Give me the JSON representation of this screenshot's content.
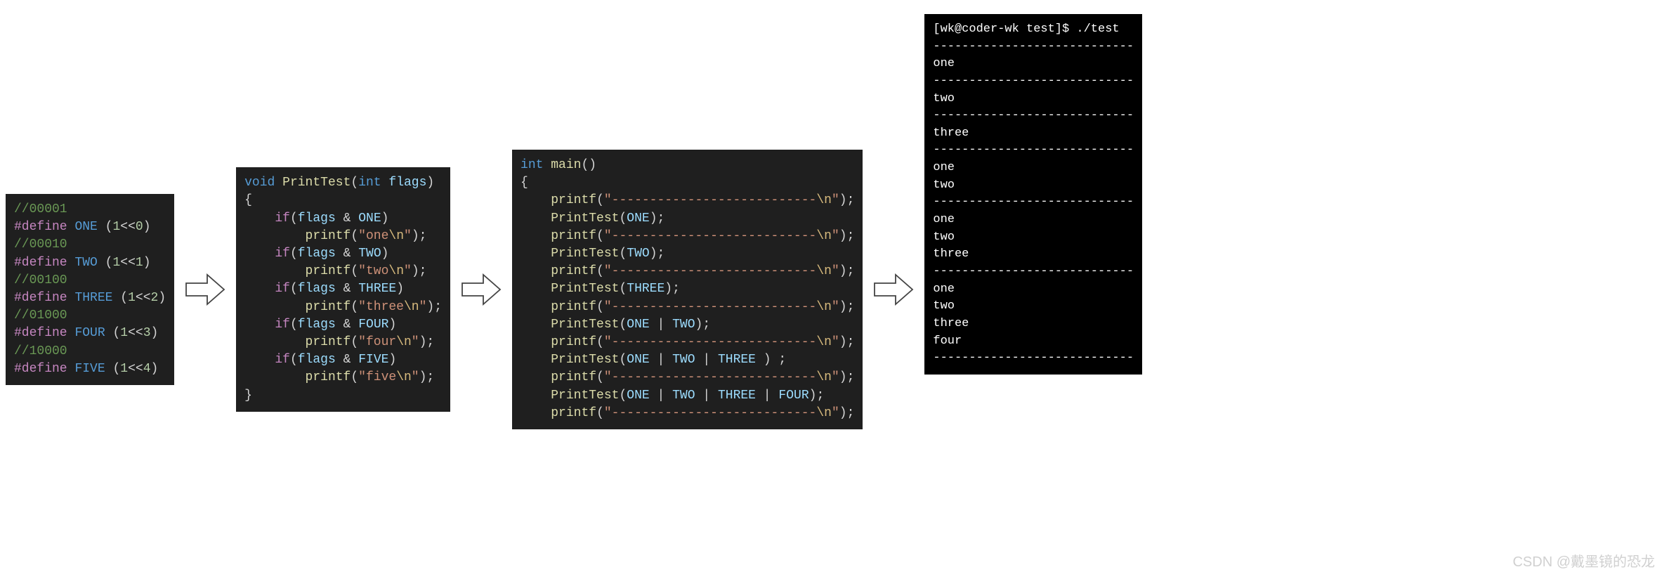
{
  "block1": {
    "lines": [
      [
        [
          "c-comment",
          "//00001"
        ]
      ],
      [
        [
          "c-kw",
          "#define"
        ],
        [
          "",
          " "
        ],
        [
          "c-define",
          "ONE"
        ],
        [
          "",
          " "
        ],
        [
          "c-paren",
          "("
        ],
        [
          "c-num",
          "1"
        ],
        [
          "c-op",
          "<<"
        ],
        [
          "c-num",
          "0"
        ],
        [
          "c-paren",
          ")"
        ]
      ],
      [
        [
          "c-comment",
          "//00010"
        ]
      ],
      [
        [
          "c-kw",
          "#define"
        ],
        [
          "",
          " "
        ],
        [
          "c-define",
          "TWO"
        ],
        [
          "",
          " "
        ],
        [
          "c-paren",
          "("
        ],
        [
          "c-num",
          "1"
        ],
        [
          "c-op",
          "<<"
        ],
        [
          "c-num",
          "1"
        ],
        [
          "c-paren",
          ")"
        ]
      ],
      [
        [
          "c-comment",
          "//00100"
        ]
      ],
      [
        [
          "c-kw",
          "#define"
        ],
        [
          "",
          " "
        ],
        [
          "c-define",
          "THREE"
        ],
        [
          "",
          " "
        ],
        [
          "c-paren",
          "("
        ],
        [
          "c-num",
          "1"
        ],
        [
          "c-op",
          "<<"
        ],
        [
          "c-num",
          "2"
        ],
        [
          "c-paren",
          ")"
        ]
      ],
      [
        [
          "c-comment",
          "//01000"
        ]
      ],
      [
        [
          "c-kw",
          "#define"
        ],
        [
          "",
          " "
        ],
        [
          "c-define",
          "FOUR"
        ],
        [
          "",
          " "
        ],
        [
          "c-paren",
          "("
        ],
        [
          "c-num",
          "1"
        ],
        [
          "c-op",
          "<<"
        ],
        [
          "c-num",
          "3"
        ],
        [
          "c-paren",
          ")"
        ]
      ],
      [
        [
          "c-comment",
          "//10000"
        ]
      ],
      [
        [
          "c-kw",
          "#define"
        ],
        [
          "",
          " "
        ],
        [
          "c-define",
          "FIVE"
        ],
        [
          "",
          " "
        ],
        [
          "c-paren",
          "("
        ],
        [
          "c-num",
          "1"
        ],
        [
          "c-op",
          "<<"
        ],
        [
          "c-num",
          "4"
        ],
        [
          "c-paren",
          ")"
        ]
      ]
    ]
  },
  "block2": {
    "lines": [
      [
        [
          "c-type",
          "void"
        ],
        [
          "",
          " "
        ],
        [
          "c-func",
          "PrintTest"
        ],
        [
          "c-paren",
          "("
        ],
        [
          "c-type",
          "int"
        ],
        [
          "",
          " "
        ],
        [
          "c-id",
          "flags"
        ],
        [
          "c-paren",
          ")"
        ]
      ],
      [
        [
          "",
          "{"
        ]
      ],
      [
        [
          "",
          "    "
        ],
        [
          "c-ret",
          "if"
        ],
        [
          "c-paren",
          "("
        ],
        [
          "c-id",
          "flags"
        ],
        [
          "",
          " "
        ],
        [
          "c-op",
          "&"
        ],
        [
          "",
          " "
        ],
        [
          "c-id",
          "ONE"
        ],
        [
          "c-paren",
          ")"
        ]
      ],
      [
        [
          "",
          "        "
        ],
        [
          "c-func",
          "printf"
        ],
        [
          "c-paren",
          "("
        ],
        [
          "c-str",
          "\"one"
        ],
        [
          "c-esc",
          "\\n"
        ],
        [
          "c-str",
          "\""
        ],
        [
          "c-paren",
          ")"
        ],
        [
          "",
          ";"
        ]
      ],
      [
        [
          "",
          "    "
        ],
        [
          "c-ret",
          "if"
        ],
        [
          "c-paren",
          "("
        ],
        [
          "c-id",
          "flags"
        ],
        [
          "",
          " "
        ],
        [
          "c-op",
          "&"
        ],
        [
          "",
          " "
        ],
        [
          "c-id",
          "TWO"
        ],
        [
          "c-paren",
          ")"
        ]
      ],
      [
        [
          "",
          "        "
        ],
        [
          "c-func",
          "printf"
        ],
        [
          "c-paren",
          "("
        ],
        [
          "c-str",
          "\"two"
        ],
        [
          "c-esc",
          "\\n"
        ],
        [
          "c-str",
          "\""
        ],
        [
          "c-paren",
          ")"
        ],
        [
          "",
          ";"
        ]
      ],
      [
        [
          "",
          "    "
        ],
        [
          "c-ret",
          "if"
        ],
        [
          "c-paren",
          "("
        ],
        [
          "c-id",
          "flags"
        ],
        [
          "",
          " "
        ],
        [
          "c-op",
          "&"
        ],
        [
          "",
          " "
        ],
        [
          "c-id",
          "THREE"
        ],
        [
          "c-paren",
          ")"
        ]
      ],
      [
        [
          "",
          "        "
        ],
        [
          "c-func",
          "printf"
        ],
        [
          "c-paren",
          "("
        ],
        [
          "c-str",
          "\"three"
        ],
        [
          "c-esc",
          "\\n"
        ],
        [
          "c-str",
          "\""
        ],
        [
          "c-paren",
          ")"
        ],
        [
          "",
          ";"
        ]
      ],
      [
        [
          "",
          "    "
        ],
        [
          "c-ret",
          "if"
        ],
        [
          "c-paren",
          "("
        ],
        [
          "c-id",
          "flags"
        ],
        [
          "",
          " "
        ],
        [
          "c-op",
          "&"
        ],
        [
          "",
          " "
        ],
        [
          "c-id",
          "FOUR"
        ],
        [
          "c-paren",
          ")"
        ]
      ],
      [
        [
          "",
          "        "
        ],
        [
          "c-func",
          "printf"
        ],
        [
          "c-paren",
          "("
        ],
        [
          "c-str",
          "\"four"
        ],
        [
          "c-esc",
          "\\n"
        ],
        [
          "c-str",
          "\""
        ],
        [
          "c-paren",
          ")"
        ],
        [
          "",
          ";"
        ]
      ],
      [
        [
          "",
          "    "
        ],
        [
          "c-ret",
          "if"
        ],
        [
          "c-paren",
          "("
        ],
        [
          "c-id",
          "flags"
        ],
        [
          "",
          " "
        ],
        [
          "c-op",
          "&"
        ],
        [
          "",
          " "
        ],
        [
          "c-id",
          "FIVE"
        ],
        [
          "c-paren",
          ")"
        ]
      ],
      [
        [
          "",
          "        "
        ],
        [
          "c-func",
          "printf"
        ],
        [
          "c-paren",
          "("
        ],
        [
          "c-str",
          "\"five"
        ],
        [
          "c-esc",
          "\\n"
        ],
        [
          "c-str",
          "\""
        ],
        [
          "c-paren",
          ")"
        ],
        [
          "",
          ";"
        ]
      ],
      [
        [
          "",
          "}"
        ]
      ]
    ]
  },
  "block3": {
    "lines": [
      [
        [
          "c-type",
          "int"
        ],
        [
          "",
          " "
        ],
        [
          "c-func",
          "main"
        ],
        [
          "c-paren",
          "("
        ],
        [
          "c-paren",
          ")"
        ]
      ],
      [
        [
          "",
          "{"
        ]
      ],
      [
        [
          "",
          "    "
        ],
        [
          "c-func",
          "printf"
        ],
        [
          "c-paren",
          "("
        ],
        [
          "c-str",
          "\"---------------------------"
        ],
        [
          "c-esc",
          "\\n"
        ],
        [
          "c-str",
          "\""
        ],
        [
          "c-paren",
          ")"
        ],
        [
          "",
          ";"
        ]
      ],
      [
        [
          "",
          "    "
        ],
        [
          "c-func",
          "PrintTest"
        ],
        [
          "c-paren",
          "("
        ],
        [
          "c-id",
          "ONE"
        ],
        [
          "c-paren",
          ")"
        ],
        [
          "",
          ";"
        ]
      ],
      [
        [
          "",
          "    "
        ],
        [
          "c-func",
          "printf"
        ],
        [
          "c-paren",
          "("
        ],
        [
          "c-str",
          "\"---------------------------"
        ],
        [
          "c-esc",
          "\\n"
        ],
        [
          "c-str",
          "\""
        ],
        [
          "c-paren",
          ")"
        ],
        [
          "",
          ";"
        ]
      ],
      [
        [
          "",
          "    "
        ],
        [
          "c-func",
          "PrintTest"
        ],
        [
          "c-paren",
          "("
        ],
        [
          "c-id",
          "TWO"
        ],
        [
          "c-paren",
          ")"
        ],
        [
          "",
          ";"
        ]
      ],
      [
        [
          "",
          "    "
        ],
        [
          "c-func",
          "printf"
        ],
        [
          "c-paren",
          "("
        ],
        [
          "c-str",
          "\"---------------------------"
        ],
        [
          "c-esc",
          "\\n"
        ],
        [
          "c-str",
          "\""
        ],
        [
          "c-paren",
          ")"
        ],
        [
          "",
          ";"
        ]
      ],
      [
        [
          "",
          "    "
        ],
        [
          "c-func",
          "PrintTest"
        ],
        [
          "c-paren",
          "("
        ],
        [
          "c-id",
          "THREE"
        ],
        [
          "c-paren",
          ")"
        ],
        [
          "",
          ";"
        ]
      ],
      [
        [
          "",
          "    "
        ],
        [
          "c-func",
          "printf"
        ],
        [
          "c-paren",
          "("
        ],
        [
          "c-str",
          "\"---------------------------"
        ],
        [
          "c-esc",
          "\\n"
        ],
        [
          "c-str",
          "\""
        ],
        [
          "c-paren",
          ")"
        ],
        [
          "",
          ";"
        ]
      ],
      [
        [
          "",
          "    "
        ],
        [
          "c-func",
          "PrintTest"
        ],
        [
          "c-paren",
          "("
        ],
        [
          "c-id",
          "ONE"
        ],
        [
          "",
          " "
        ],
        [
          "c-op",
          "|"
        ],
        [
          "",
          " "
        ],
        [
          "c-id",
          "TWO"
        ],
        [
          "c-paren",
          ")"
        ],
        [
          "",
          ";"
        ]
      ],
      [
        [
          "",
          "    "
        ],
        [
          "c-func",
          "printf"
        ],
        [
          "c-paren",
          "("
        ],
        [
          "c-str",
          "\"---------------------------"
        ],
        [
          "c-esc",
          "\\n"
        ],
        [
          "c-str",
          "\""
        ],
        [
          "c-paren",
          ")"
        ],
        [
          "",
          ";"
        ]
      ],
      [
        [
          "",
          "    "
        ],
        [
          "c-func",
          "PrintTest"
        ],
        [
          "c-paren",
          "("
        ],
        [
          "c-id",
          "ONE"
        ],
        [
          "",
          " "
        ],
        [
          "c-op",
          "|"
        ],
        [
          "",
          " "
        ],
        [
          "c-id",
          "TWO"
        ],
        [
          "",
          " "
        ],
        [
          "c-op",
          "|"
        ],
        [
          "",
          " "
        ],
        [
          "c-id",
          "THREE"
        ],
        [
          "",
          " "
        ],
        [
          "c-paren",
          ")"
        ],
        [
          "",
          " ;"
        ]
      ],
      [
        [
          "",
          "    "
        ],
        [
          "c-func",
          "printf"
        ],
        [
          "c-paren",
          "("
        ],
        [
          "c-str",
          "\"---------------------------"
        ],
        [
          "c-esc",
          "\\n"
        ],
        [
          "c-str",
          "\""
        ],
        [
          "c-paren",
          ")"
        ],
        [
          "",
          ";"
        ]
      ],
      [
        [
          "",
          "    "
        ],
        [
          "c-func",
          "PrintTest"
        ],
        [
          "c-paren",
          "("
        ],
        [
          "c-id",
          "ONE"
        ],
        [
          "",
          " "
        ],
        [
          "c-op",
          "|"
        ],
        [
          "",
          " "
        ],
        [
          "c-id",
          "TWO"
        ],
        [
          "",
          " "
        ],
        [
          "c-op",
          "|"
        ],
        [
          "",
          " "
        ],
        [
          "c-id",
          "THREE"
        ],
        [
          "",
          " "
        ],
        [
          "c-op",
          "|"
        ],
        [
          "",
          " "
        ],
        [
          "c-id",
          "FOUR"
        ],
        [
          "c-paren",
          ")"
        ],
        [
          "",
          ";"
        ]
      ],
      [
        [
          "",
          "    "
        ],
        [
          "c-func",
          "printf"
        ],
        [
          "c-paren",
          "("
        ],
        [
          "c-str",
          "\"---------------------------"
        ],
        [
          "c-esc",
          "\\n"
        ],
        [
          "c-str",
          "\""
        ],
        [
          "c-paren",
          ")"
        ],
        [
          "",
          ";"
        ]
      ]
    ]
  },
  "terminal": {
    "lines": [
      "[wk@coder-wk test]$ ./test",
      "----------------------------",
      "one",
      "----------------------------",
      "two",
      "----------------------------",
      "three",
      "----------------------------",
      "one",
      "two",
      "----------------------------",
      "one",
      "two",
      "three",
      "----------------------------",
      "one",
      "two",
      "three",
      "four",
      "----------------------------"
    ]
  },
  "watermark": "CSDN @戴墨镜的恐龙"
}
